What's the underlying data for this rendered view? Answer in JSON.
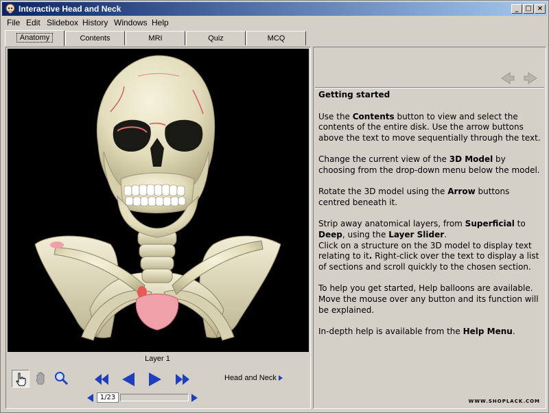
{
  "window": {
    "title": "Interactive Head and Neck",
    "min_glyph": "_",
    "max_glyph": "□",
    "close_glyph": "×"
  },
  "menu": [
    "File",
    "Edit",
    "Slidebox",
    "History",
    "Windows",
    "Help"
  ],
  "tabs": [
    {
      "label": "Anatomy",
      "active": true
    },
    {
      "label": "Contents",
      "active": false
    },
    {
      "label": "MRI",
      "active": false
    },
    {
      "label": "Quiz",
      "active": false
    },
    {
      "label": "MCQ",
      "active": false
    }
  ],
  "model": {
    "layer_label": "Layer 1",
    "view_selector": "Head and Neck",
    "slider_value": "1/23",
    "slider_fraction": 0.0
  },
  "tools": [
    "hand-pointer-icon",
    "grab-hand-icon",
    "magnifier-icon"
  ],
  "navigation": [
    "rewind-icon",
    "rotate-left-icon",
    "rotate-right-icon",
    "fast-forward-icon"
  ],
  "text_panel": {
    "heading": "Getting started",
    "paragraphs": [
      [
        {
          "t": "Use the "
        },
        {
          "t": "Contents",
          "b": true
        },
        {
          "t": " button to view and select the contents of the entire disk.  Use the arrow buttons above the text to move sequentially through the text."
        }
      ],
      [
        {
          "t": "Change the current view of the "
        },
        {
          "t": "3D Model",
          "b": true
        },
        {
          "t": " by choosing from the drop-down menu below the model."
        }
      ],
      [
        {
          "t": "Rotate the 3D model using the "
        },
        {
          "t": "Arrow",
          "b": true
        },
        {
          "t": " buttons centred beneath it."
        }
      ],
      [
        {
          "t": "Strip away anatomical layers, from "
        },
        {
          "t": "Superficial",
          "b": true
        },
        {
          "t": " to "
        },
        {
          "t": "Deep",
          "b": true
        },
        {
          "t": ", using the "
        },
        {
          "t": "Layer Slider",
          "b": true
        },
        {
          "t": ".",
          "br": true
        },
        {
          "t": "Click on a structure on the 3D model to display text relating to it"
        },
        {
          "t": ".",
          "b": true
        },
        {
          "t": " Right-click over the text to display a list of sections and scroll quickly to the chosen section."
        }
      ],
      [
        {
          "t": "To help you get started, Help balloons are available. Move the mouse over any button and its function will be explained."
        }
      ],
      [
        {
          "t": "In-depth help is available from the "
        },
        {
          "t": "Help Menu",
          "b": true
        },
        {
          "t": "."
        }
      ]
    ],
    "watermark": "WWW.SHOPLACK.COM"
  },
  "colors": {
    "title_start": "#0a246a",
    "title_end": "#a6caf0",
    "nav_blue": "#1f3fbf",
    "bone": "#e8e3c6",
    "cartilage": "#f0a0a8"
  }
}
